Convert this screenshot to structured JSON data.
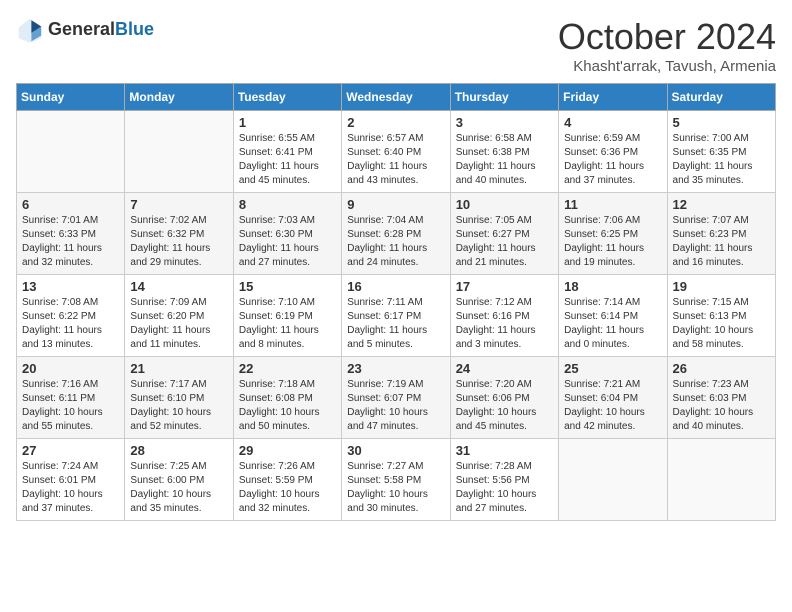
{
  "logo": {
    "general": "General",
    "blue": "Blue"
  },
  "header": {
    "month": "October 2024",
    "location": "Khasht'arrak, Tavush, Armenia"
  },
  "days_of_week": [
    "Sunday",
    "Monday",
    "Tuesday",
    "Wednesday",
    "Thursday",
    "Friday",
    "Saturday"
  ],
  "weeks": [
    [
      {
        "day": "",
        "sunrise": "",
        "sunset": "",
        "daylight": ""
      },
      {
        "day": "",
        "sunrise": "",
        "sunset": "",
        "daylight": ""
      },
      {
        "day": "1",
        "sunrise": "Sunrise: 6:55 AM",
        "sunset": "Sunset: 6:41 PM",
        "daylight": "Daylight: 11 hours and 45 minutes."
      },
      {
        "day": "2",
        "sunrise": "Sunrise: 6:57 AM",
        "sunset": "Sunset: 6:40 PM",
        "daylight": "Daylight: 11 hours and 43 minutes."
      },
      {
        "day": "3",
        "sunrise": "Sunrise: 6:58 AM",
        "sunset": "Sunset: 6:38 PM",
        "daylight": "Daylight: 11 hours and 40 minutes."
      },
      {
        "day": "4",
        "sunrise": "Sunrise: 6:59 AM",
        "sunset": "Sunset: 6:36 PM",
        "daylight": "Daylight: 11 hours and 37 minutes."
      },
      {
        "day": "5",
        "sunrise": "Sunrise: 7:00 AM",
        "sunset": "Sunset: 6:35 PM",
        "daylight": "Daylight: 11 hours and 35 minutes."
      }
    ],
    [
      {
        "day": "6",
        "sunrise": "Sunrise: 7:01 AM",
        "sunset": "Sunset: 6:33 PM",
        "daylight": "Daylight: 11 hours and 32 minutes."
      },
      {
        "day": "7",
        "sunrise": "Sunrise: 7:02 AM",
        "sunset": "Sunset: 6:32 PM",
        "daylight": "Daylight: 11 hours and 29 minutes."
      },
      {
        "day": "8",
        "sunrise": "Sunrise: 7:03 AM",
        "sunset": "Sunset: 6:30 PM",
        "daylight": "Daylight: 11 hours and 27 minutes."
      },
      {
        "day": "9",
        "sunrise": "Sunrise: 7:04 AM",
        "sunset": "Sunset: 6:28 PM",
        "daylight": "Daylight: 11 hours and 24 minutes."
      },
      {
        "day": "10",
        "sunrise": "Sunrise: 7:05 AM",
        "sunset": "Sunset: 6:27 PM",
        "daylight": "Daylight: 11 hours and 21 minutes."
      },
      {
        "day": "11",
        "sunrise": "Sunrise: 7:06 AM",
        "sunset": "Sunset: 6:25 PM",
        "daylight": "Daylight: 11 hours and 19 minutes."
      },
      {
        "day": "12",
        "sunrise": "Sunrise: 7:07 AM",
        "sunset": "Sunset: 6:23 PM",
        "daylight": "Daylight: 11 hours and 16 minutes."
      }
    ],
    [
      {
        "day": "13",
        "sunrise": "Sunrise: 7:08 AM",
        "sunset": "Sunset: 6:22 PM",
        "daylight": "Daylight: 11 hours and 13 minutes."
      },
      {
        "day": "14",
        "sunrise": "Sunrise: 7:09 AM",
        "sunset": "Sunset: 6:20 PM",
        "daylight": "Daylight: 11 hours and 11 minutes."
      },
      {
        "day": "15",
        "sunrise": "Sunrise: 7:10 AM",
        "sunset": "Sunset: 6:19 PM",
        "daylight": "Daylight: 11 hours and 8 minutes."
      },
      {
        "day": "16",
        "sunrise": "Sunrise: 7:11 AM",
        "sunset": "Sunset: 6:17 PM",
        "daylight": "Daylight: 11 hours and 5 minutes."
      },
      {
        "day": "17",
        "sunrise": "Sunrise: 7:12 AM",
        "sunset": "Sunset: 6:16 PM",
        "daylight": "Daylight: 11 hours and 3 minutes."
      },
      {
        "day": "18",
        "sunrise": "Sunrise: 7:14 AM",
        "sunset": "Sunset: 6:14 PM",
        "daylight": "Daylight: 11 hours and 0 minutes."
      },
      {
        "day": "19",
        "sunrise": "Sunrise: 7:15 AM",
        "sunset": "Sunset: 6:13 PM",
        "daylight": "Daylight: 10 hours and 58 minutes."
      }
    ],
    [
      {
        "day": "20",
        "sunrise": "Sunrise: 7:16 AM",
        "sunset": "Sunset: 6:11 PM",
        "daylight": "Daylight: 10 hours and 55 minutes."
      },
      {
        "day": "21",
        "sunrise": "Sunrise: 7:17 AM",
        "sunset": "Sunset: 6:10 PM",
        "daylight": "Daylight: 10 hours and 52 minutes."
      },
      {
        "day": "22",
        "sunrise": "Sunrise: 7:18 AM",
        "sunset": "Sunset: 6:08 PM",
        "daylight": "Daylight: 10 hours and 50 minutes."
      },
      {
        "day": "23",
        "sunrise": "Sunrise: 7:19 AM",
        "sunset": "Sunset: 6:07 PM",
        "daylight": "Daylight: 10 hours and 47 minutes."
      },
      {
        "day": "24",
        "sunrise": "Sunrise: 7:20 AM",
        "sunset": "Sunset: 6:06 PM",
        "daylight": "Daylight: 10 hours and 45 minutes."
      },
      {
        "day": "25",
        "sunrise": "Sunrise: 7:21 AM",
        "sunset": "Sunset: 6:04 PM",
        "daylight": "Daylight: 10 hours and 42 minutes."
      },
      {
        "day": "26",
        "sunrise": "Sunrise: 7:23 AM",
        "sunset": "Sunset: 6:03 PM",
        "daylight": "Daylight: 10 hours and 40 minutes."
      }
    ],
    [
      {
        "day": "27",
        "sunrise": "Sunrise: 7:24 AM",
        "sunset": "Sunset: 6:01 PM",
        "daylight": "Daylight: 10 hours and 37 minutes."
      },
      {
        "day": "28",
        "sunrise": "Sunrise: 7:25 AM",
        "sunset": "Sunset: 6:00 PM",
        "daylight": "Daylight: 10 hours and 35 minutes."
      },
      {
        "day": "29",
        "sunrise": "Sunrise: 7:26 AM",
        "sunset": "Sunset: 5:59 PM",
        "daylight": "Daylight: 10 hours and 32 minutes."
      },
      {
        "day": "30",
        "sunrise": "Sunrise: 7:27 AM",
        "sunset": "Sunset: 5:58 PM",
        "daylight": "Daylight: 10 hours and 30 minutes."
      },
      {
        "day": "31",
        "sunrise": "Sunrise: 7:28 AM",
        "sunset": "Sunset: 5:56 PM",
        "daylight": "Daylight: 10 hours and 27 minutes."
      },
      {
        "day": "",
        "sunrise": "",
        "sunset": "",
        "daylight": ""
      },
      {
        "day": "",
        "sunrise": "",
        "sunset": "",
        "daylight": ""
      }
    ]
  ]
}
